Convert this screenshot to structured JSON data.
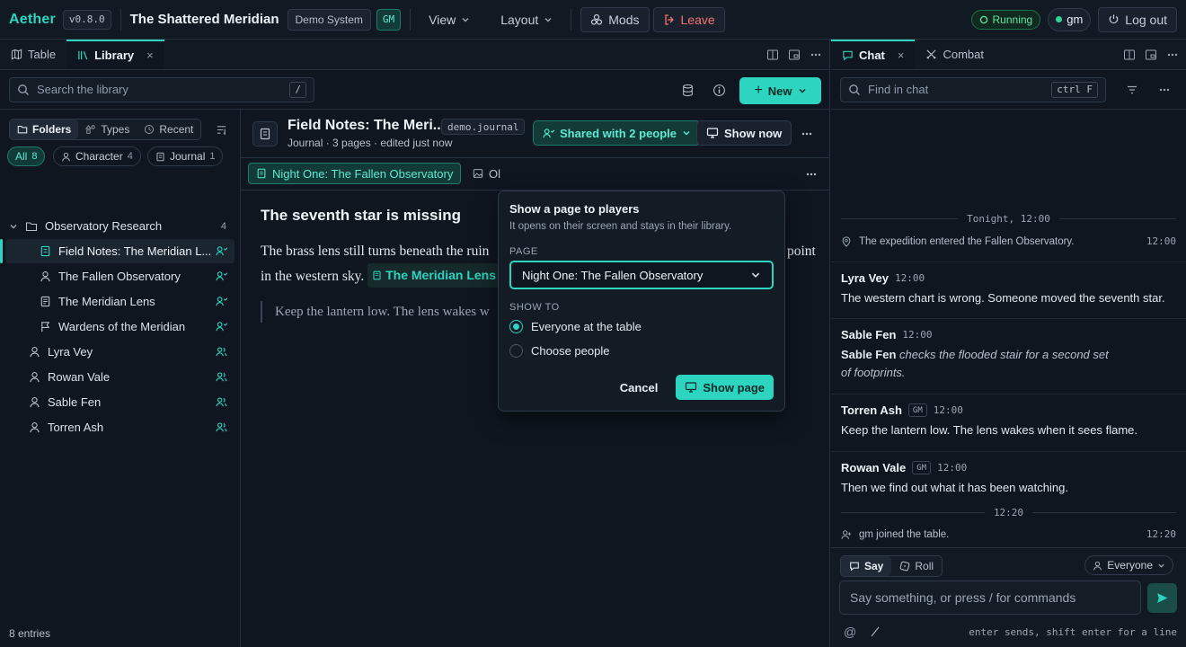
{
  "app": {
    "logo": "Aether",
    "version": "v0.8.0",
    "session_title": "The Shattered Meridian",
    "system_chip": "Demo System",
    "gm_chip": "GM"
  },
  "topbar": {
    "view": "View",
    "layout": "Layout",
    "mods": "Mods",
    "leave": "Leave",
    "status": "Running",
    "user": "gm",
    "logout": "Log out"
  },
  "left_tabs": [
    {
      "label": "Table"
    },
    {
      "label": "Library"
    }
  ],
  "library": {
    "search_placeholder": "Search the library",
    "search_kbd": "/",
    "new_label": "New",
    "views": [
      "Folders",
      "Types",
      "Recent"
    ],
    "filters": [
      {
        "label": "All",
        "count": "8"
      },
      {
        "label": "Character",
        "count": "4"
      },
      {
        "label": "Journal",
        "count": "1"
      }
    ],
    "folder": {
      "name": "Observatory Research",
      "count": "4"
    },
    "entries": [
      "Field Notes: The Meridian L...",
      "The Fallen Observatory",
      "The Meridian Lens",
      "Wardens of the Meridian"
    ],
    "characters": [
      "Lyra Vey",
      "Rowan Vale",
      "Sable Fen",
      "Torren Ash"
    ],
    "footer": "8 entries"
  },
  "document": {
    "title": "Field Notes: The Meri...",
    "tag": "demo.journal",
    "subtitle": "Journal · 3 pages · edited just now",
    "share_label": "Shared with 2 people",
    "show_now": "Show now",
    "page_tab_active": "Night One: The Fallen Observatory",
    "page_tab_2": "Ol",
    "heading": "The seventh star is missing",
    "para_1a": "The brass lens still turns beneath the ruin",
    "para_1b": "point",
    "para_2": "in the western sky.",
    "link_label": "The Meridian Lens",
    "quote": "Keep the lantern low. The lens wakes w"
  },
  "popover": {
    "title": "Show a page to players",
    "subtitle": "It opens on their screen and stays in their library.",
    "page_label": "PAGE",
    "page_value": "Night One: The Fallen Observatory",
    "show_to_label": "SHOW TO",
    "option_everyone": "Everyone at the table",
    "option_choose": "Choose people",
    "cancel": "Cancel",
    "confirm": "Show page"
  },
  "right_tabs": [
    {
      "label": "Chat"
    },
    {
      "label": "Combat"
    }
  ],
  "chat": {
    "search_placeholder": "Find in chat",
    "search_kbd": "ctrl F",
    "divider_1": "Tonight, 12:00",
    "system_1": {
      "text": "The expedition entered the Fallen Observatory.",
      "time": "12:00"
    },
    "messages": [
      {
        "name": "Lyra Vey",
        "time": "12:00",
        "text": "The western chart is wrong. Someone moved the seventh star."
      },
      {
        "name": "Sable Fen",
        "time": "12:00",
        "actor": "Sable Fen",
        "action": "checks the flooded stair for a second set of footprints."
      },
      {
        "name": "Torren Ash",
        "gm": "GM",
        "time": "12:00",
        "text": "Keep the lantern low. The lens wakes when it sees flame."
      },
      {
        "name": "Rowan Vale",
        "gm": "GM",
        "time": "12:00",
        "text": "Then we find out what it has been watching."
      }
    ],
    "divider_2": "12:20",
    "system_2": {
      "text": "gm joined the table.",
      "time": "12:20"
    },
    "mode_say": "Say",
    "mode_roll": "Roll",
    "audience": "Everyone",
    "input_placeholder": "Say something, or press / for commands",
    "hint": "enter sends, shift enter for a line"
  },
  "colors": {
    "accent": "#2dd4bf",
    "danger": "#f87171",
    "status": "#5ee6a0",
    "bg": "#0f1620"
  }
}
